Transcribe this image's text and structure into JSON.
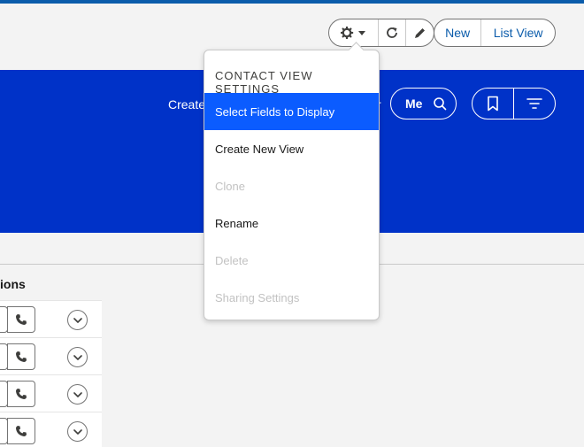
{
  "toolbar": {
    "settings_icon": "gear-icon",
    "dropdown_caret": "caret-down-icon",
    "refresh_icon": "refresh-icon",
    "edit_icon": "pencil-icon",
    "new_label": "New",
    "list_view_label": "List View"
  },
  "band": {
    "create_text": "Create",
    "partial_text": "r",
    "me_label": "Me",
    "search_icon": "search-icon",
    "bookmark_icon": "bookmark-icon",
    "filter_icon": "filter-icon",
    "color": "#0032c8"
  },
  "table": {
    "column_header": "ions",
    "row_icons": [
      "phone-icon",
      "chevron-down-icon"
    ]
  },
  "dropdown": {
    "title": "CONTACT VIEW SETTINGS",
    "items": [
      {
        "label": "Select Fields to Display",
        "state": "selected"
      },
      {
        "label": "Create New View",
        "state": "enabled"
      },
      {
        "label": "Clone",
        "state": "disabled"
      },
      {
        "label": "Rename",
        "state": "enabled"
      },
      {
        "label": "Delete",
        "state": "disabled"
      },
      {
        "label": "Sharing Settings",
        "state": "disabled"
      }
    ]
  },
  "colors": {
    "accent": "#0b5cab",
    "selected": "#0b5cff"
  }
}
